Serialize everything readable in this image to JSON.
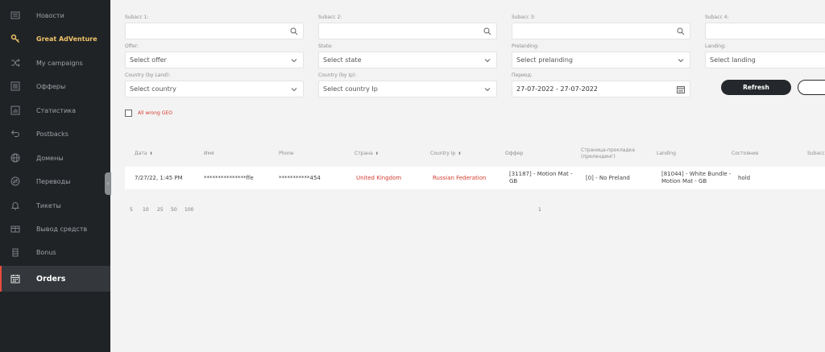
{
  "sidebar": {
    "items": [
      {
        "label": "Новости",
        "icon": "news-icon"
      },
      {
        "label": "Great AdVenture",
        "icon": "key-icon"
      },
      {
        "label": "My campaigns",
        "icon": "shuffle-icon"
      },
      {
        "label": "Офферы",
        "icon": "list-icon"
      },
      {
        "label": "Статистика",
        "icon": "bar-chart-icon"
      },
      {
        "label": "Postbacks",
        "icon": "return-arrow-icon"
      },
      {
        "label": "Домены",
        "icon": "globe-icon"
      },
      {
        "label": "Переводы",
        "icon": "transfer-icon"
      },
      {
        "label": "Тикеты",
        "icon": "bell-icon"
      },
      {
        "label": "Вывод средств",
        "icon": "wallet-icon"
      },
      {
        "label": "Bonus",
        "icon": "bonus-icon"
      },
      {
        "label": "Orders",
        "icon": "calendar-icon"
      }
    ]
  },
  "filters": {
    "subacc1": {
      "label": "Subacc 1:",
      "value": ""
    },
    "subacc2": {
      "label": "Subacc 2:",
      "value": ""
    },
    "subacc3": {
      "label": "Subacc 3:",
      "value": ""
    },
    "subacc4": {
      "label": "Subacc 4:",
      "value": ""
    },
    "offer": {
      "label": "Offer:",
      "value": "Select offer"
    },
    "state": {
      "label": "State:",
      "value": "Select state"
    },
    "prelanding": {
      "label": "Prelanding:",
      "value": "Select prelanding"
    },
    "landing": {
      "label": "Landing:",
      "value": "Select landing"
    },
    "country_land": {
      "label": "Country (by Land):",
      "value": "Select country"
    },
    "country_ip": {
      "label": "Country (by Ip):",
      "value": "Select country Ip"
    },
    "period": {
      "label": "Период:",
      "value": "27-07-2022 - 27-07-2022"
    },
    "refresh_label": "Refresh",
    "wrong_geo_label": "All wrong GEO"
  },
  "table": {
    "columns": [
      {
        "label": "Дата",
        "sortable": true
      },
      {
        "label": "Имя",
        "sortable": false
      },
      {
        "label": "Phone",
        "sortable": false
      },
      {
        "label": "Страна",
        "sortable": true
      },
      {
        "label": "Country Ip",
        "sortable": true
      },
      {
        "label": "Оффер",
        "sortable": false
      },
      {
        "label": "Страница-прокладка",
        "label2": "(прелендинг)",
        "sortable": false
      },
      {
        "label": "Landing",
        "sortable": false
      },
      {
        "label": "Состояние",
        "sortable": false
      },
      {
        "label": "Subacc",
        "sortable": false
      }
    ],
    "rows": [
      {
        "date": "7/27/22, 1:45 PM",
        "name": "***************ffe",
        "phone": "***********454",
        "country": "United Kingdom",
        "country_ip": "Russian Federation",
        "offer_line1": "[31187] - Motion Mat -",
        "offer_line2": "GB",
        "prelanding": "[0] - No Preland",
        "landing_line1": "[81044] - White Bundle -",
        "landing_line2": "Motion Mat - GB",
        "state": "hold"
      }
    ]
  },
  "pagination": {
    "page_sizes": [
      "5",
      "10",
      "25",
      "50",
      "100"
    ],
    "current_page": "1"
  }
}
